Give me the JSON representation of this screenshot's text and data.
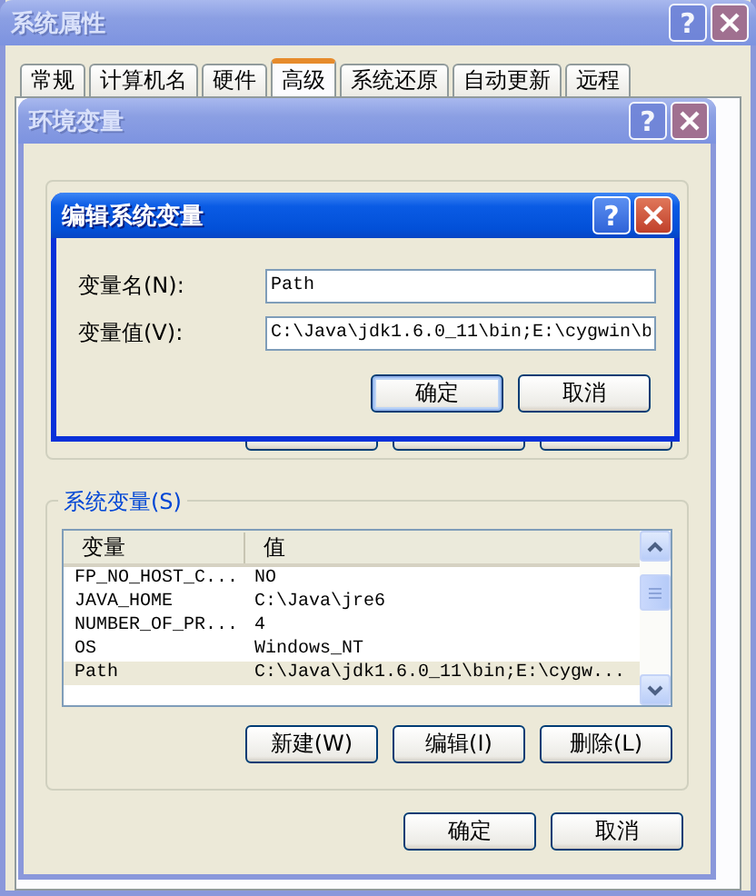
{
  "system_properties": {
    "title": "系统属性",
    "active": false,
    "help": "?",
    "tabs": [
      {
        "label": "常规",
        "selected": false
      },
      {
        "label": "计算机名",
        "selected": false
      },
      {
        "label": "硬件",
        "selected": false
      },
      {
        "label": "高级",
        "selected": true
      },
      {
        "label": "系统还原",
        "selected": false
      },
      {
        "label": "自动更新",
        "selected": false
      },
      {
        "label": "远程",
        "selected": false
      }
    ]
  },
  "environment_variables": {
    "title": "环境变量",
    "active": false,
    "help": "?",
    "system_variables": {
      "legend": "系统变量(S)",
      "columns": [
        "变量",
        "值"
      ],
      "rows": [
        {
          "name": "FP_NO_HOST_C...",
          "value": "NO",
          "selected": false
        },
        {
          "name": "JAVA_HOME",
          "value": "C:\\Java\\jre6",
          "selected": false
        },
        {
          "name": "NUMBER_OF_PR...",
          "value": "4",
          "selected": false
        },
        {
          "name": "OS",
          "value": "Windows_NT",
          "selected": false
        },
        {
          "name": "Path",
          "value": "C:\\Java\\jdk1.6.0_11\\bin;E:\\cygw...",
          "selected": true
        }
      ],
      "buttons": [
        "新建(W)",
        "编辑(I)",
        "删除(L)"
      ]
    },
    "buttons": [
      "确定",
      "取消"
    ]
  },
  "edit_dialog": {
    "title": "编辑系统变量",
    "active": true,
    "help": "?",
    "fields": [
      {
        "label": "变量名(N):",
        "value": "Path"
      },
      {
        "label": "变量值(V):",
        "value": "C:\\Java\\jdk1.6.0_11\\bin;E:\\cygwin\\b"
      }
    ],
    "buttons": [
      {
        "label": "确定",
        "default": true
      },
      {
        "label": "取消",
        "default": false
      }
    ]
  }
}
